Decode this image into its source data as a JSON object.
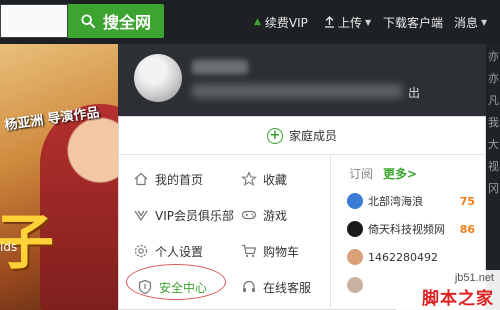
{
  "search": {
    "button_label": "搜全网"
  },
  "nav": {
    "vip": "续费VIP",
    "upload": "上传",
    "download": "下载客户端",
    "messages": "消息"
  },
  "background": {
    "promo_line": "杨亚洲 导演作品",
    "big_glyph": "子",
    "ids_text": "ids",
    "right_chars": [
      "亦",
      "亦",
      "凡",
      "我",
      "大",
      "视",
      "冈"
    ]
  },
  "header": {
    "tail": "出"
  },
  "family": {
    "label": "家庭成员"
  },
  "menu": [
    {
      "label": "我的首页",
      "icon": "home-icon"
    },
    {
      "label": "收藏",
      "icon": "star-icon"
    },
    {
      "label": "VIP会员俱乐部",
      "icon": "vip-icon"
    },
    {
      "label": "游戏",
      "icon": "gamepad-icon"
    },
    {
      "label": "个人设置",
      "icon": "gear-icon"
    },
    {
      "label": "购物车",
      "icon": "cart-icon"
    },
    {
      "label": "安全中心",
      "icon": "shield-icon"
    },
    {
      "label": "在线客服",
      "icon": "headset-icon"
    }
  ],
  "subscriptions": {
    "title": "订阅",
    "more": "更多>",
    "items": [
      {
        "name": "北部湾海浪",
        "count": "75",
        "color": "#3a7bd5"
      },
      {
        "name": "倚天科技视频网",
        "count": "86",
        "color": "#1a1a1a"
      },
      {
        "name": "1462280492",
        "count": "",
        "color": "#d9a07a"
      },
      {
        "name": "",
        "count": "",
        "color": "#c9b2a0"
      }
    ]
  },
  "watermark": {
    "url": "jb51.net",
    "brand": "脚本之家"
  },
  "colors": {
    "accent": "#3ea431",
    "count": "#f07c1a",
    "ring": "#e25a5a"
  }
}
